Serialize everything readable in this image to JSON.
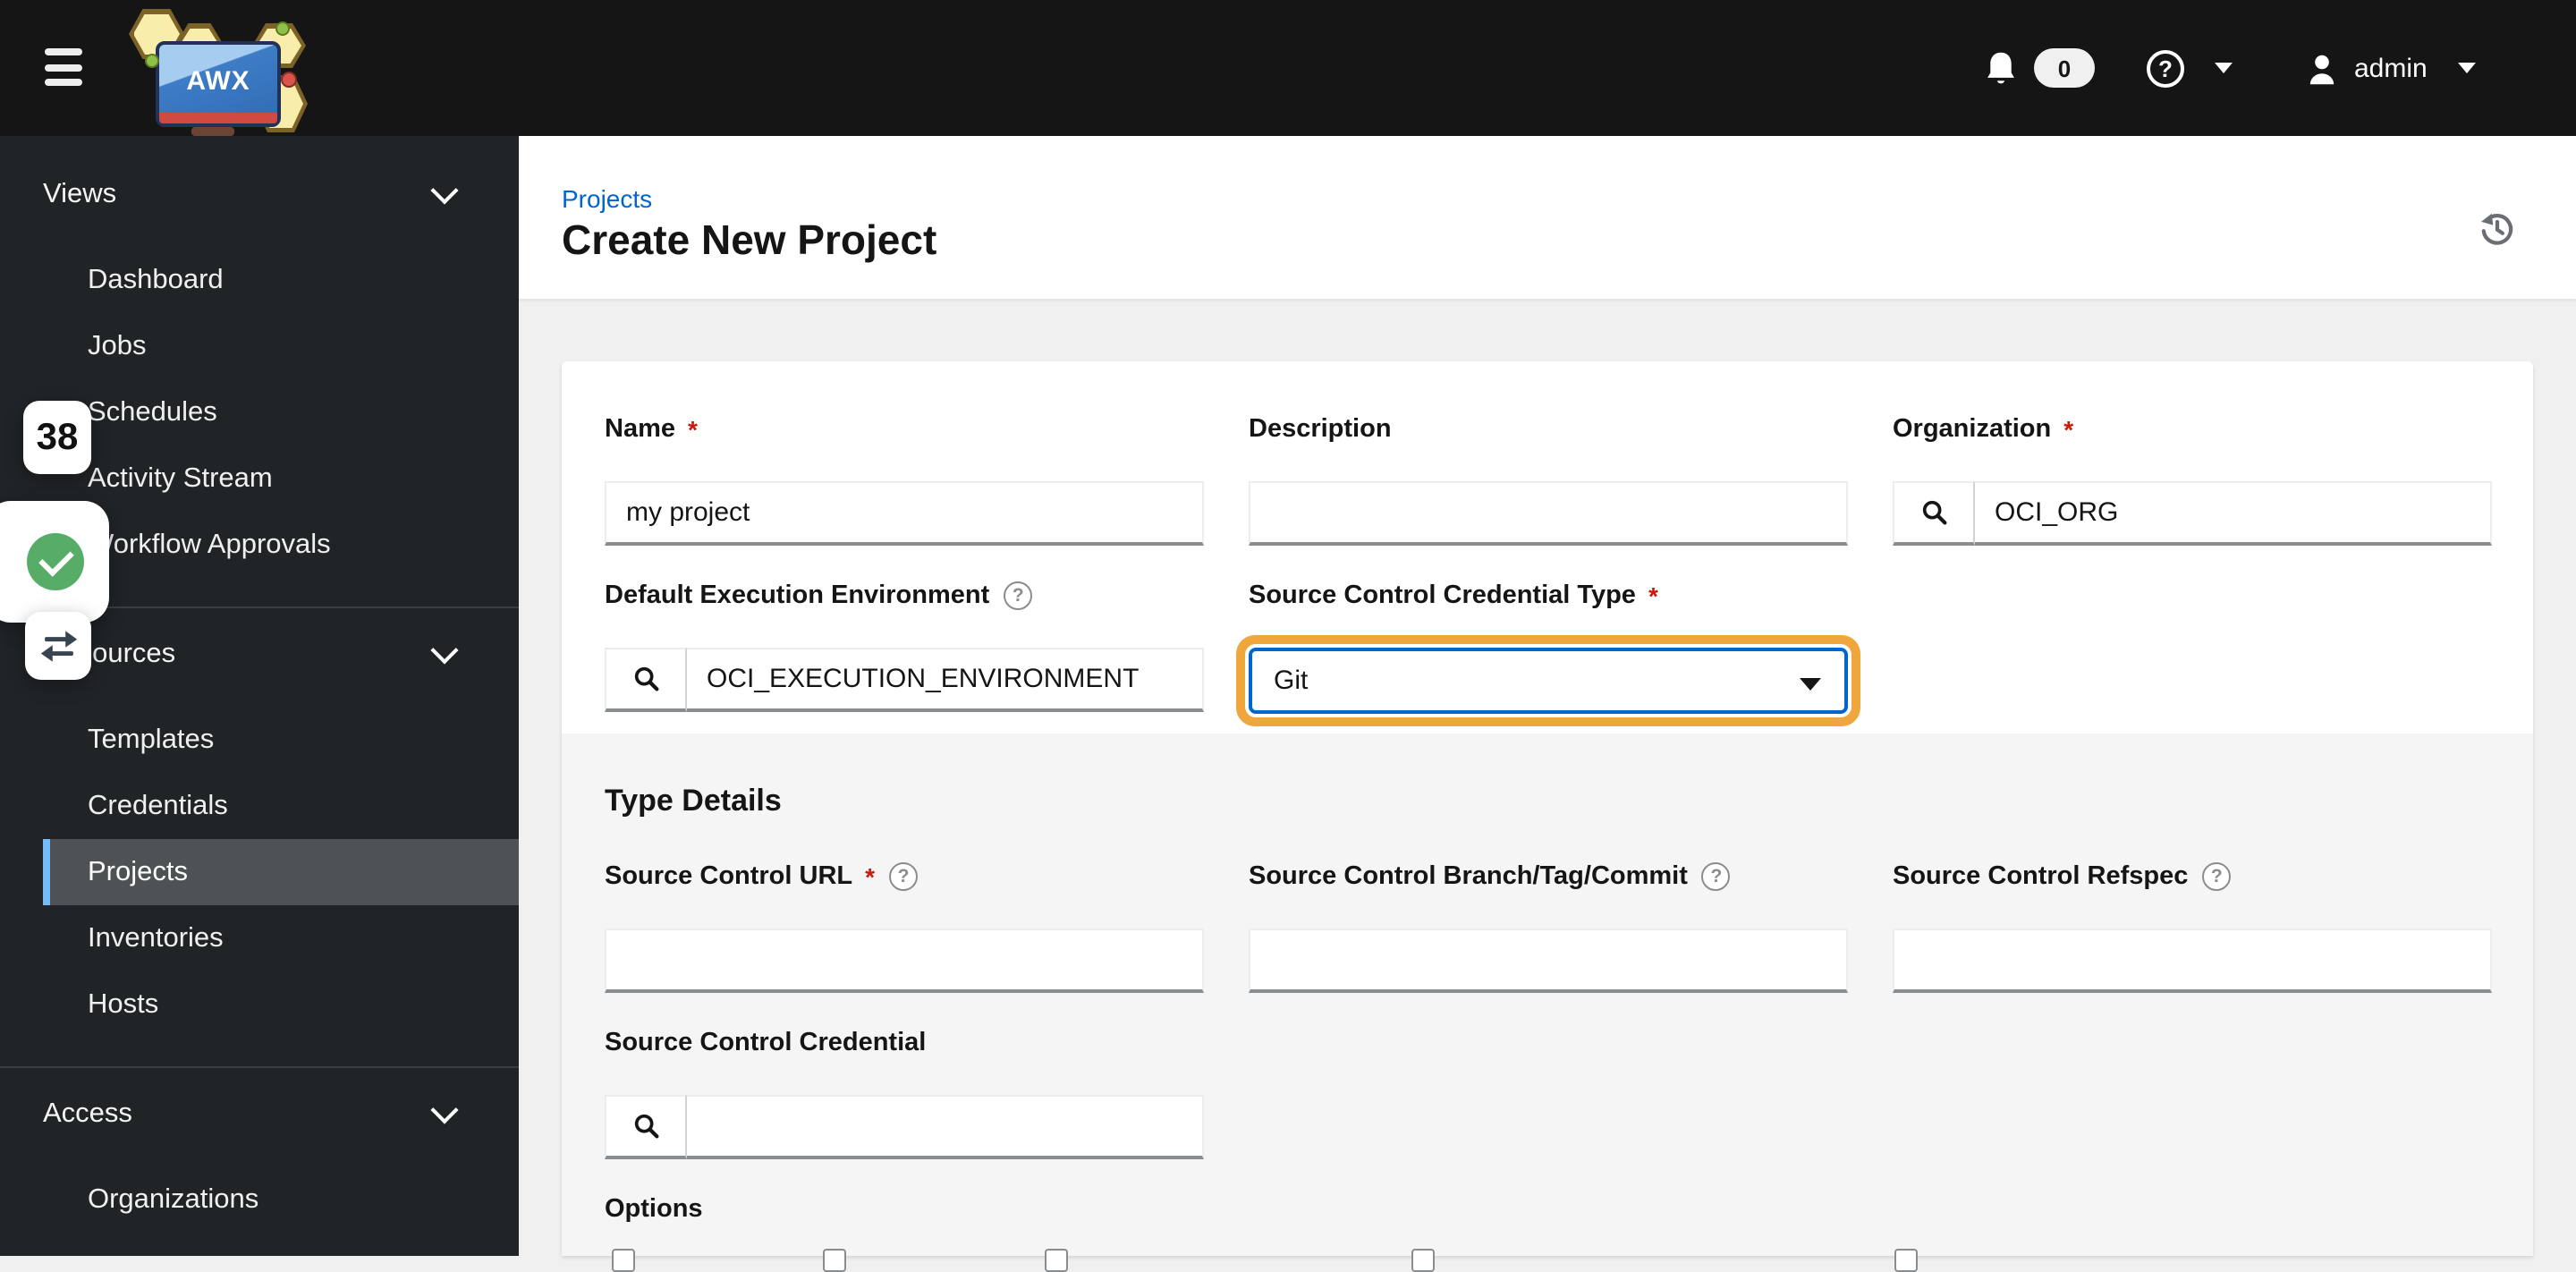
{
  "masthead": {
    "logo_text": "AWX",
    "notifications_badge": "0",
    "help_glyph": "?",
    "username": "admin"
  },
  "sidebar": {
    "groups": [
      {
        "label": "Views",
        "items": [
          {
            "label": "Dashboard",
            "current": false
          },
          {
            "label": "Jobs",
            "current": false
          },
          {
            "label": "Schedules",
            "current": false
          },
          {
            "label": "Activity Stream",
            "current": false
          },
          {
            "label": "Workflow Approvals",
            "current": false
          }
        ]
      },
      {
        "label": "Resources",
        "items": [
          {
            "label": "Templates",
            "current": false
          },
          {
            "label": "Credentials",
            "current": false
          },
          {
            "label": "Projects",
            "current": true
          },
          {
            "label": "Inventories",
            "current": false
          },
          {
            "label": "Hosts",
            "current": false
          }
        ]
      },
      {
        "label": "Access",
        "items": [
          {
            "label": "Organizations",
            "current": false
          }
        ]
      }
    ]
  },
  "overlays": {
    "counter_badge": "38"
  },
  "page": {
    "breadcrumb": "Projects",
    "title": "Create New Project"
  },
  "form": {
    "required_indicator": "*",
    "help_glyph": "?",
    "fields": {
      "name": {
        "label": "Name",
        "required": true,
        "value": "my project"
      },
      "description": {
        "label": "Description",
        "required": false,
        "value": ""
      },
      "organization": {
        "label": "Organization",
        "required": true,
        "value": "OCI_ORG"
      },
      "default_execution_environment": {
        "label": "Default Execution Environment",
        "has_help": true,
        "value": "OCI_EXECUTION_ENVIRONMENT"
      },
      "scm_credential_type": {
        "label": "Source Control Credential Type",
        "required": true,
        "value": "Git",
        "highlighted": true
      },
      "scm_url": {
        "label": "Source Control URL",
        "required": true,
        "has_help": true,
        "value": ""
      },
      "scm_branch": {
        "label": "Source Control Branch/Tag/Commit",
        "has_help": true,
        "value": ""
      },
      "scm_refspec": {
        "label": "Source Control Refspec",
        "has_help": true,
        "value": ""
      },
      "scm_credential": {
        "label": "Source Control Credential",
        "value": ""
      }
    },
    "sections": {
      "type_details": "Type Details",
      "options": "Options"
    },
    "options_checkbox_count": 5
  },
  "colors": {
    "masthead_bg": "#151515",
    "sidebar_bg": "#212427",
    "sidebar_current_bg": "#4f5255",
    "sidebar_current_accent": "#73bcf7",
    "link_blue": "#0066cc",
    "focus_border_blue": "#0066cc",
    "highlight_ring_orange": "#efa63d",
    "required_red": "#c9190b",
    "page_bg": "#f0f0f0",
    "dimmed_section_bg": "#f5f5f5",
    "input_bottom_border": "#8a8d90",
    "success_green": "#57ad68"
  }
}
